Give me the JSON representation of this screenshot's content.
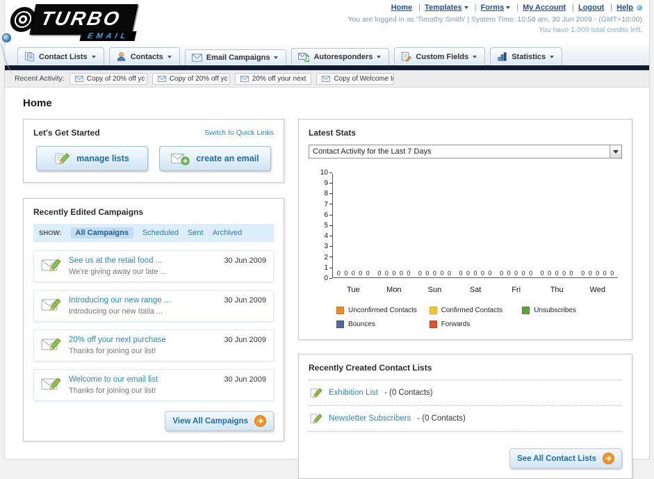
{
  "header": {
    "logo_line1": "TURBO",
    "logo_line2": "EMAIL",
    "links": [
      "Home",
      "Templates",
      "Forms",
      "My Account",
      "Logout",
      "Help"
    ],
    "login_info": "You are logged in as 'Timothy Smith' | System Time: 10:58 am, 30 Jun 2009 - (GMT+10:00)",
    "credits": "You have 1,000 total credits left."
  },
  "nav": {
    "items": [
      {
        "label": "Contact Lists"
      },
      {
        "label": "Contacts"
      },
      {
        "label": "Email Campaigns"
      },
      {
        "label": "Autoresponders"
      },
      {
        "label": "Custom Fields"
      },
      {
        "label": "Statistics"
      }
    ]
  },
  "activity": {
    "label": "Recent Activity:",
    "items": [
      "Copy of 20% off yc",
      "Copy of 20% off yc",
      "20% off your next",
      "Copy of Welcome tc"
    ]
  },
  "page_title": "Home",
  "get_started": {
    "title": "Let's Get Started",
    "switch_link": "Switch to Quick Links",
    "manage_lists_label": "manage lists",
    "create_email_label": "create an email"
  },
  "campaigns": {
    "title": "Recently Edited Campaigns",
    "show_label": "SHOW:",
    "filters": [
      "All Campaigns",
      "Scheduled",
      "Sent",
      "Archived"
    ],
    "items": [
      {
        "title": "See us at the retail food ...",
        "subtitle": "We're giving away our late ...",
        "date": "30 Jun 2009"
      },
      {
        "title": "Introducing our new range ...",
        "subtitle": "Introducing our new Italia ...",
        "date": "30 Jun 2009"
      },
      {
        "title": "20% off your next purchase",
        "subtitle": "Thanks for joining our list!",
        "date": "30 Jun 2009"
      },
      {
        "title": "Welcome to our email list",
        "subtitle": "Thanks for joining our list!",
        "date": "30 Jun 2009"
      }
    ],
    "view_all_label": "View All Campaigns"
  },
  "stats": {
    "title": "Latest Stats",
    "period_selector": "Contact Activity for the Last 7 Days"
  },
  "chart_data": {
    "type": "bar",
    "title": "Contact Activity for the Last 7 Days",
    "categories": [
      "Tue",
      "Mon",
      "Sun",
      "Sat",
      "Fri",
      "Thu",
      "Wed"
    ],
    "series": [
      {
        "name": "Unconfirmed Contacts",
        "color": "#f28b24",
        "values": [
          0,
          0,
          0,
          0,
          0,
          0,
          0
        ]
      },
      {
        "name": "Confirmed Contacts",
        "color": "#fdc52d",
        "values": [
          0,
          0,
          0,
          0,
          0,
          0,
          0
        ]
      },
      {
        "name": "Unsubscribes",
        "color": "#57a639",
        "values": [
          0,
          0,
          0,
          0,
          0,
          0,
          0
        ]
      },
      {
        "name": "Bounces",
        "color": "#51699f",
        "values": [
          0,
          0,
          0,
          0,
          0,
          0,
          0
        ]
      },
      {
        "name": "Forwards",
        "color": "#e8502a",
        "values": [
          0,
          0,
          0,
          0,
          0,
          0,
          0
        ]
      }
    ],
    "ylim": [
      0,
      10
    ],
    "ytick_step": 1,
    "grid": false,
    "legend_position": "bottom"
  },
  "contact_lists": {
    "title": "Recently Created Contact Lists",
    "items": [
      {
        "name": "Exhibition List",
        "suffix": "- (0 Contacts)"
      },
      {
        "name": "Newsletter Subscribers",
        "suffix": "- (0 Contacts)"
      }
    ],
    "see_all_label": "See All Contact Lists"
  }
}
